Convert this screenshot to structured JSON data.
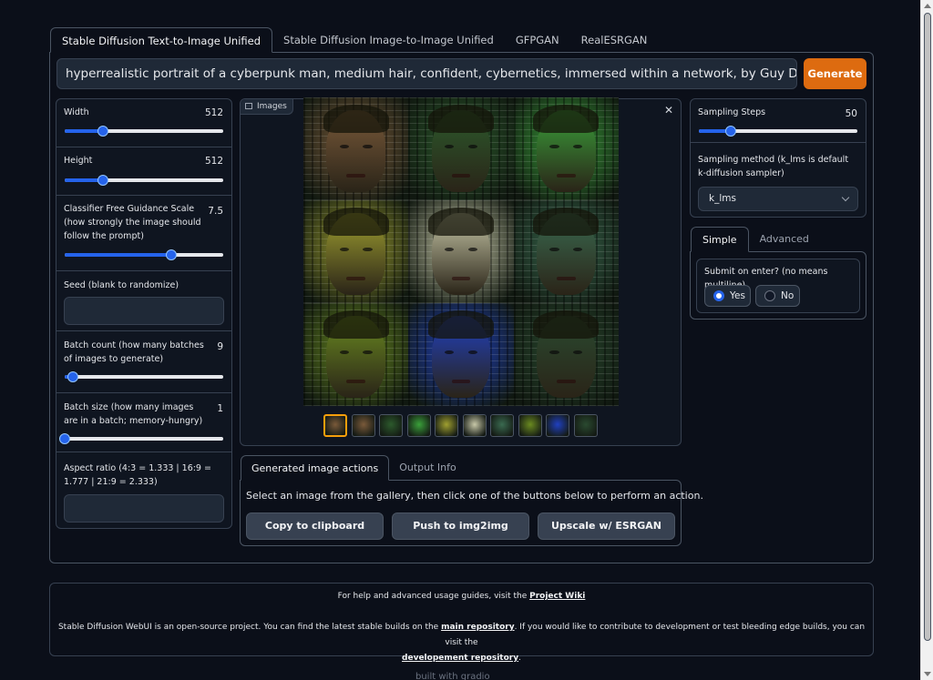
{
  "tabs": [
    "Stable Diffusion Text-to-Image Unified",
    "Stable Diffusion Image-to-Image Unified",
    "GFPGAN",
    "RealESRGAN"
  ],
  "prompt": "hyperrealistic portrait of a cyberpunk man, medium hair, confident, cybernetics, immersed within a network, by Guy Denning, Derek Gores",
  "generate_label": "Generate",
  "left": {
    "width": {
      "label": "Width",
      "value": "512",
      "fraction": 0.24
    },
    "height": {
      "label": "Height",
      "value": "512",
      "fraction": 0.24
    },
    "cfg": {
      "label": "Classifier Free Guidance Scale (how strongly the image should follow the prompt)",
      "value": "7.5",
      "fraction": 0.67
    },
    "seed": {
      "label": "Seed (blank to randomize)",
      "value": ""
    },
    "batch_count": {
      "label": "Batch count (how many batches of images to generate)",
      "value": "9",
      "fraction": 0.05
    },
    "batch_size": {
      "label": "Batch size (how many images are in a batch; memory-hungry)",
      "value": "1",
      "fraction": 0.0
    },
    "aspect": {
      "label": "Aspect ratio (4:3 = 1.333 | 16:9 = 1.777 | 21:9 = 2.333)",
      "value": ""
    }
  },
  "gallery": {
    "label": "Images",
    "image_palette": [
      "#7a5a3a",
      "#2c5a2c",
      "#3aa03a",
      "#a0a030",
      "#c8c8a8",
      "#3a6a50",
      "#6a8a20",
      "#2040c0",
      "#2a4a30"
    ],
    "thumb_count": 10
  },
  "actions": {
    "tabs": [
      "Generated image actions",
      "Output Info"
    ],
    "message": "Select an image from the gallery, then click one of the buttons below to perform an action.",
    "buttons": [
      "Copy to clipboard",
      "Push to img2img",
      "Upscale w/ ESRGAN"
    ]
  },
  "right": {
    "steps": {
      "label": "Sampling Steps",
      "value": "50",
      "fraction": 0.2
    },
    "method": {
      "label": "Sampling method (k_lms is default k-diffusion sampler)",
      "value": "k_lms"
    },
    "tabs": [
      "Simple",
      "Advanced"
    ],
    "submit_label": "Submit on enter? (no means multiline)",
    "yes": "Yes",
    "no": "No",
    "selected": "Yes"
  },
  "footer": {
    "line1_pre": "For help and advanced usage guides, visit the",
    "wiki": "Project Wiki",
    "line2_pre": "Stable Diffusion WebUI is an open-source project. You can find the latest stable builds on the",
    "main_repo": "main repository",
    "line2_mid": ". If you would like to contribute to development or test bleeding edge builds, you can visit the",
    "dev_repo": "developement repository",
    "end": ".",
    "built_with": "built with gradio"
  }
}
